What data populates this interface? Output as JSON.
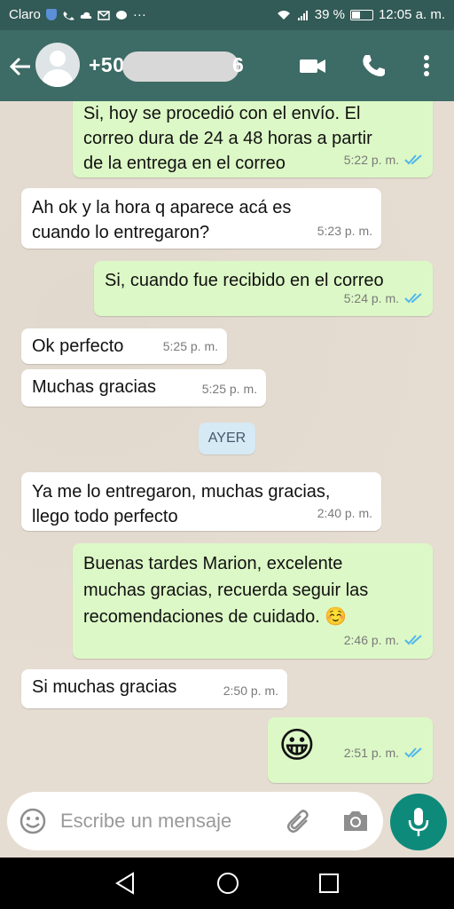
{
  "status_bar": {
    "carrier": "Claro",
    "battery_percent": "39 %",
    "battery_level": 0.39,
    "time": "12:05 a. m."
  },
  "header": {
    "contact_prefix": "+50",
    "contact_suffix": "6",
    "icons": [
      "back-arrow-icon",
      "video-call-icon",
      "phone-icon",
      "more-vertical-icon"
    ]
  },
  "messages": [
    {
      "dir": "out",
      "lines": [
        "Si, hoy se procedió con el envío. El",
        "correo dura de 24 a 48 horas a partir",
        "de la entrega en el correo"
      ],
      "time": "5:22 p. m.",
      "read": true
    },
    {
      "dir": "in",
      "lines": [
        "Ah ok y la hora q aparece acá es",
        "cuando lo entregaron?"
      ],
      "time": "5:23 p. m."
    },
    {
      "dir": "out",
      "lines": [
        "Si, cuando fue recibido en el correo"
      ],
      "time": "5:24 p. m.",
      "read": true
    },
    {
      "dir": "in",
      "lines": [
        "Ok perfecto"
      ],
      "time": "5:25 p. m."
    },
    {
      "dir": "in",
      "lines": [
        "Muchas gracias"
      ],
      "time": "5:25 p. m."
    },
    {
      "dir": "in",
      "lines": [
        "Ya me lo entregaron, muchas gracias,",
        "llego todo perfecto"
      ],
      "time": "2:40 p. m."
    },
    {
      "dir": "out",
      "lines": [
        "Buenas tardes Marion, excelente",
        "muchas gracias, recuerda seguir las",
        "recomendaciones de cuidado. ☺️"
      ],
      "time": "2:46 p. m.",
      "read": true
    },
    {
      "dir": "in",
      "lines": [
        "Si muchas gracias"
      ],
      "time": "2:50 p. m."
    },
    {
      "dir": "out",
      "lines": [
        "😀"
      ],
      "time": "2:51 p. m.",
      "read": true
    }
  ],
  "day_chip": "AYER",
  "composer": {
    "placeholder": "Escribe un mensaje"
  }
}
